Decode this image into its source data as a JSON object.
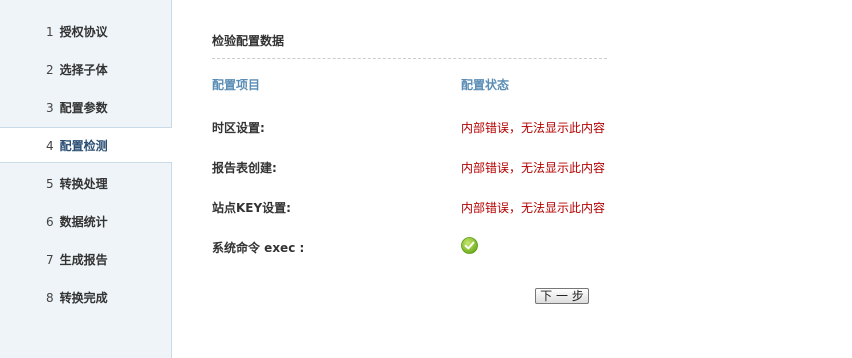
{
  "sidebar": {
    "items": [
      {
        "num": "1",
        "label": "授权协议",
        "active": false
      },
      {
        "num": "2",
        "label": "选择子体",
        "active": false
      },
      {
        "num": "3",
        "label": "配置参数",
        "active": false
      },
      {
        "num": "4",
        "label": "配置检测",
        "active": true
      },
      {
        "num": "5",
        "label": "转换处理",
        "active": false
      },
      {
        "num": "6",
        "label": "数据统计",
        "active": false
      },
      {
        "num": "7",
        "label": "生成报告",
        "active": false
      },
      {
        "num": "8",
        "label": "转换完成",
        "active": false
      }
    ]
  },
  "main": {
    "title": "检验配置数据",
    "columns": {
      "item": "配置项目",
      "status": "配置状态"
    },
    "rows": [
      {
        "label": "时区设置:",
        "status": "内部错误，无法显示此内容"
      },
      {
        "label": "报告表创建:",
        "status": "内部错误，无法显示此内容"
      },
      {
        "label": "站点KEY设置:",
        "status": "内部错误，无法显示此内容"
      },
      {
        "label": "系统命令 exec :",
        "status_icon": "check-icon"
      }
    ],
    "next_button": "下 一 步"
  },
  "colors": {
    "sidebar_bg": "#eef4f8",
    "active_text": "#2a4f73",
    "column_head": "#5a8db5",
    "error_text": "#b40000",
    "ok_green": "#8cc63f"
  }
}
